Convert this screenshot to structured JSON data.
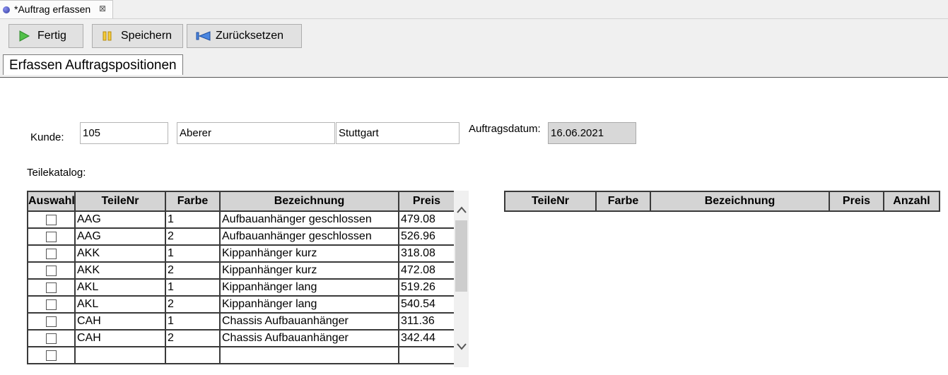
{
  "editor_tab": {
    "title": "*Auftrag erfassen",
    "close_symbol": "⊠"
  },
  "toolbar": {
    "fertig_label": "Fertig",
    "speichern_label": "Speichern",
    "zuruecksetzen_label": "Zurücksetzen"
  },
  "section_title": "Erfassen Auftragspositionen",
  "form": {
    "kunde_label": "Kunde:",
    "kunde_nr": "105",
    "kunde_name": "Aberer",
    "kunde_ort": "Stuttgart",
    "auftragsdatum_label": "Auftragsdatum:",
    "auftragsdatum": "16.06.2021",
    "teilekatalog_label": "Teilekatalog:"
  },
  "catalog_table": {
    "headers": [
      "Auswahl",
      "TeileNr",
      "Farbe",
      "Bezeichnung",
      "Preis"
    ],
    "rows": [
      {
        "nr": "AAG",
        "farbe": "1",
        "bez": "Aufbauanhänger geschlossen",
        "preis": "479.08"
      },
      {
        "nr": "AAG",
        "farbe": "2",
        "bez": "Aufbauanhänger geschlossen",
        "preis": "526.96"
      },
      {
        "nr": "AKK",
        "farbe": "1",
        "bez": "Kippanhänger kurz",
        "preis": "318.08"
      },
      {
        "nr": "AKK",
        "farbe": "2",
        "bez": "Kippanhänger kurz",
        "preis": "472.08"
      },
      {
        "nr": "AKL",
        "farbe": "1",
        "bez": "Kippanhänger lang",
        "preis": "519.26"
      },
      {
        "nr": "AKL",
        "farbe": "2",
        "bez": "Kippanhänger lang",
        "preis": "540.54"
      },
      {
        "nr": "CAH",
        "farbe": "1",
        "bez": "Chassis Aufbauanhänger",
        "preis": "311.36"
      },
      {
        "nr": "CAH",
        "farbe": "2",
        "bez": "Chassis Aufbauanhänger",
        "preis": "342.44"
      }
    ]
  },
  "positions_table": {
    "headers": [
      "TeileNr",
      "Farbe",
      "Bezeichnung",
      "Preis",
      "Anzahl"
    ]
  },
  "colors": {
    "play_green": "#2e9b3a",
    "pause_yellow": "#e0b020",
    "rewind_blue": "#2f6fd0"
  }
}
